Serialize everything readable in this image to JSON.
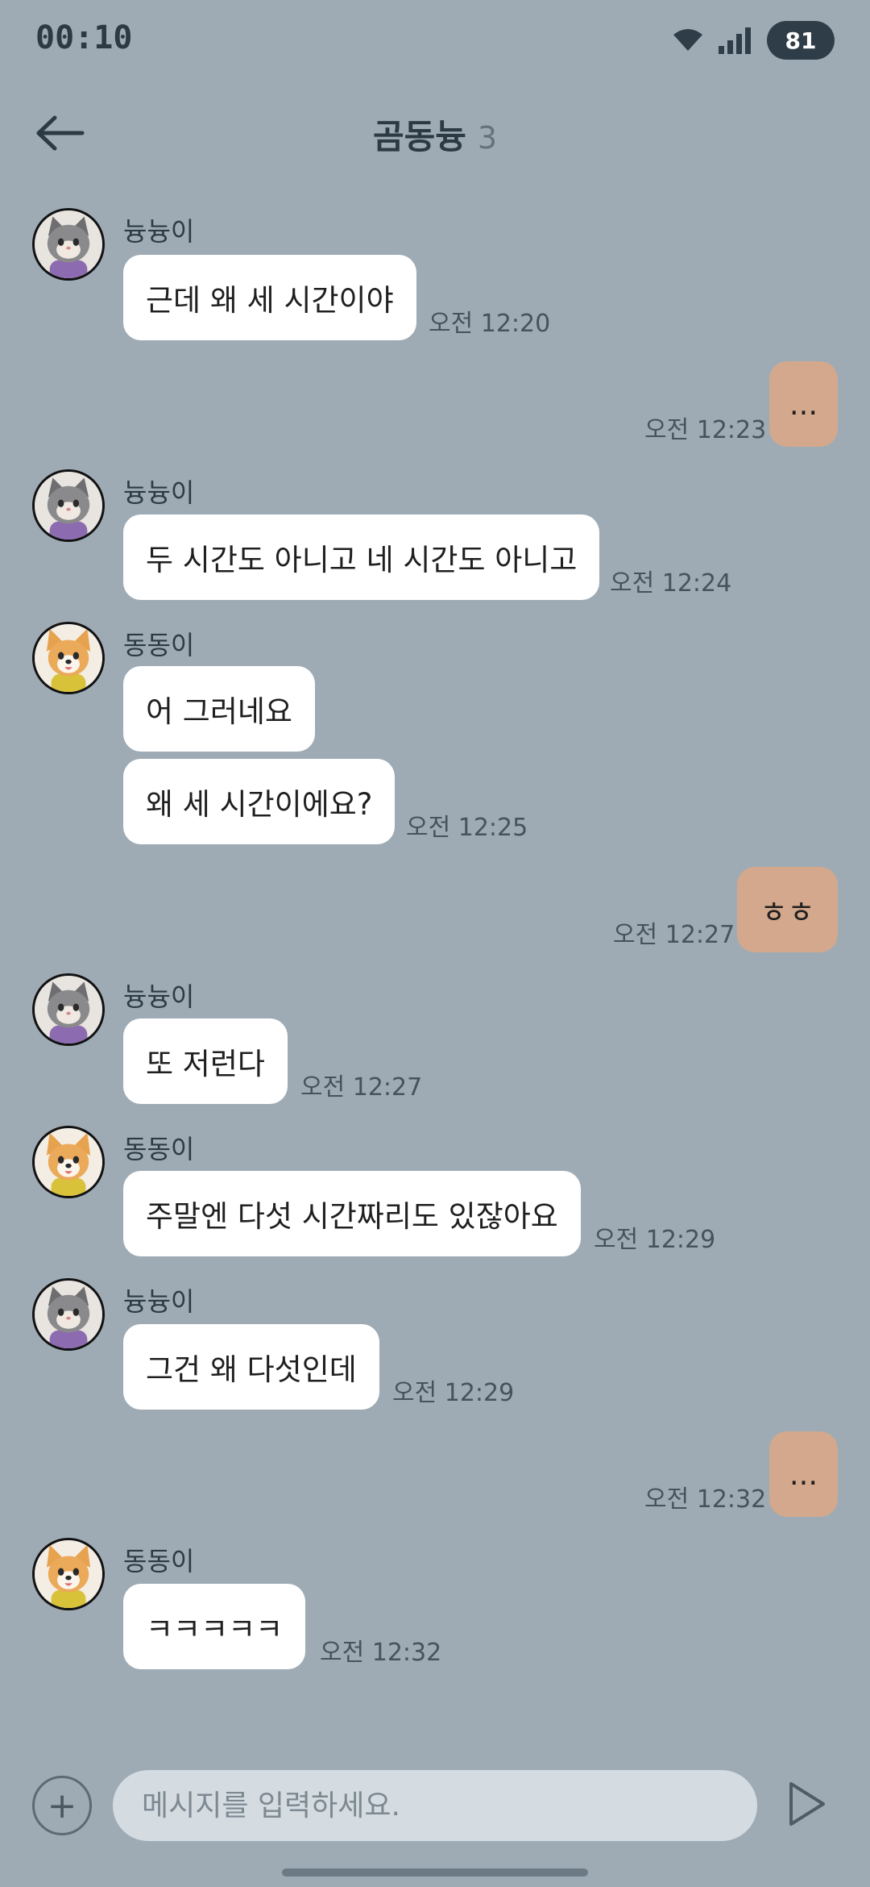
{
  "status_bar": {
    "time": "00:10",
    "battery": "81"
  },
  "header": {
    "title": "곰동늉",
    "member_count": "3"
  },
  "messages": [
    {
      "sender": "늉늉이",
      "text": "근데 왜 세 시간이야",
      "time": "오전 12:20"
    },
    {
      "text": "...",
      "time": "오전 12:23"
    },
    {
      "sender": "늉늉이",
      "text": "두 시간도 아니고 네 시간도 아니고",
      "time": "오전 12:24"
    },
    {
      "sender": "동동이",
      "text": "어 그러네요"
    },
    {
      "text": "왜 세 시간이에요?",
      "time": "오전 12:25"
    },
    {
      "text": "ㅎㅎ",
      "time": "오전 12:27"
    },
    {
      "sender": "늉늉이",
      "text": "또 저런다",
      "time": "오전 12:27"
    },
    {
      "sender": "동동이",
      "text": "주말엔 다섯 시간짜리도 있잖아요",
      "time": "오전 12:29"
    },
    {
      "sender": "늉늉이",
      "text": "그건 왜 다섯인데",
      "time": "오전 12:29"
    },
    {
      "text": "...",
      "time": "오전 12:32"
    },
    {
      "sender": "동동이",
      "text": "ㅋㅋㅋㅋㅋ",
      "time": "오전 12:32"
    }
  ],
  "input": {
    "placeholder": "메시지를 입력하세요."
  },
  "icons": {
    "back": "arrow-left-icon",
    "add": "plus-icon",
    "send": "send-icon",
    "wifi": "wifi-icon",
    "signal": "signal-icon",
    "cat_avatar": "cat-avatar-icon",
    "dog_avatar": "dog-avatar-icon"
  },
  "colors": {
    "background": "#9eabb5",
    "incoming_bubble": "#ffffff",
    "outgoing_bubble": "#d3a88c",
    "input_field": "#d4dce2"
  }
}
